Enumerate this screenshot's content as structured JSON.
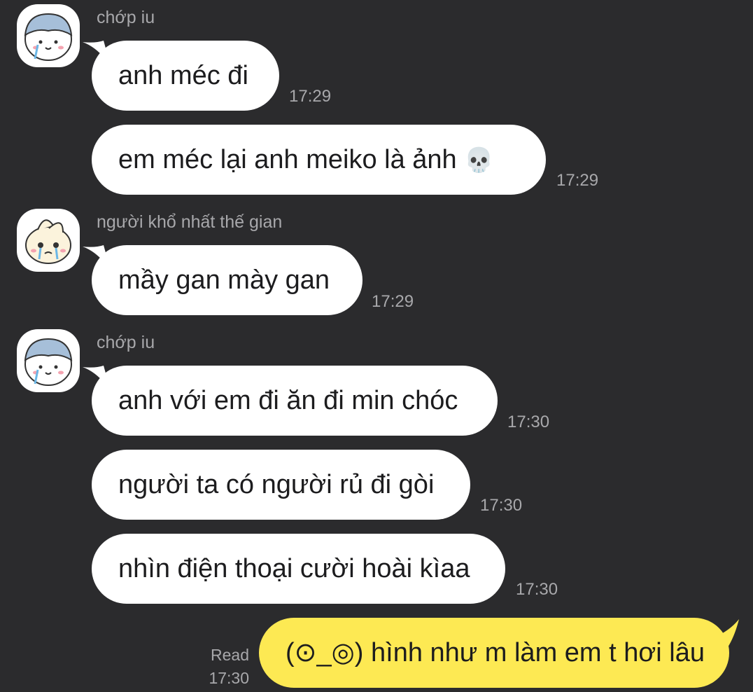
{
  "chat": {
    "messages": [
      {
        "sender": "chớp iu",
        "text": "anh méc đi",
        "time": "17:29"
      },
      {
        "text": "em méc lại anh meiko là ảnh",
        "emoji": "💀",
        "time": "17:29"
      },
      {
        "sender": "người khổ nhất thế gian",
        "text": "mầy gan mày gan",
        "time": "17:29"
      },
      {
        "sender": "chớp iu",
        "text": "anh với em đi ăn đi min chóc",
        "time": "17:30"
      },
      {
        "text": "người ta có người rủ đi gòi",
        "time": "17:30"
      },
      {
        "text": "nhìn điện thoại cười hoài kìaa",
        "time": "17:30"
      }
    ],
    "my_message": {
      "text": "(⊙_◎) hình như m làm em t hơi lâu",
      "read_label": "Read",
      "time": "17:30"
    }
  },
  "colors": {
    "background": "#2b2b2d",
    "incoming_bubble": "#ffffff",
    "outgoing_bubble": "#fde953",
    "meta_text": "#a8a8ab"
  },
  "icons": {
    "avatar_1": "crying-blue-hat-avatar-icon",
    "avatar_2": "crying-bunny-avatar-icon",
    "skull": "skull-emoji"
  }
}
